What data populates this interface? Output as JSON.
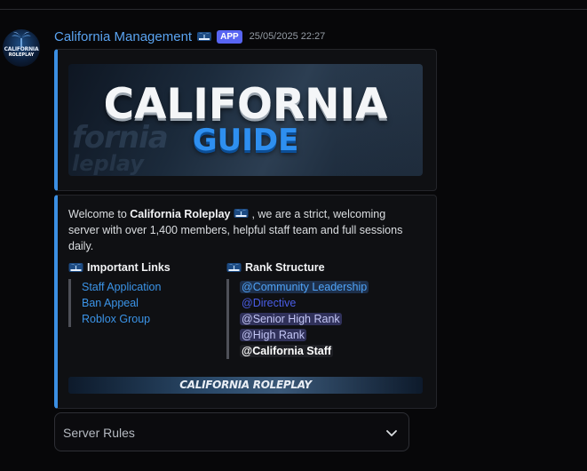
{
  "message": {
    "author": "California Management",
    "badge": "APP",
    "timestamp": "25/05/2025 22:27",
    "avatar_text_line1": "CALIFORNIA",
    "avatar_text_line2": "ROLEPLAY"
  },
  "banner": {
    "title": "CALIFORNIA",
    "subtitle": "GUIDE"
  },
  "embed": {
    "welcome_prefix": "Welcome to ",
    "welcome_bold": "California Roleplay",
    "welcome_suffix": " , we are a strict, welcoming server with over 1,400 members, helpful staff team and full sessions daily.",
    "links_title": "Important Links",
    "links": [
      "Staff Application",
      "Ban Appeal",
      "Roblox Group"
    ],
    "ranks_title": "Rank Structure",
    "ranks": [
      "@Community Leadership",
      "@Directive",
      "@Senior High Rank",
      "@High Rank",
      "@California Staff"
    ],
    "footer_banner": "CALIFORNIA ROLEPLAY"
  },
  "select_menu": {
    "placeholder": "Server Rules"
  },
  "colors": {
    "accent": "#3b8fe3",
    "author": "#5aa3f0",
    "app_badge": "#5865f2",
    "background": "#070709"
  },
  "icons": [
    "california-emoji-icon",
    "chevron-down-icon"
  ]
}
